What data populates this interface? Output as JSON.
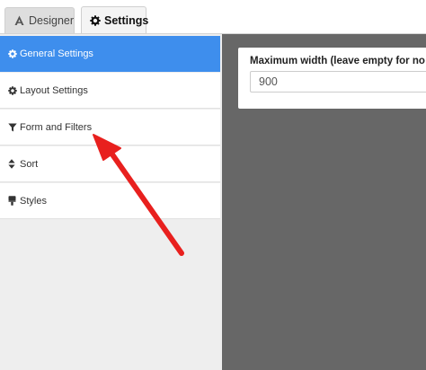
{
  "tabs": [
    {
      "label": "Designer",
      "icon": "designer-icon"
    },
    {
      "label": "Settings",
      "icon": "gear-icon"
    }
  ],
  "sidebar": {
    "items": [
      {
        "label": "General Settings",
        "icon": "gear-icon",
        "active": true
      },
      {
        "label": "Layout Settings",
        "icon": "gear-icon"
      },
      {
        "label": "Form and Filters",
        "icon": "filter-icon"
      },
      {
        "label": "Sort",
        "icon": "sort-icon"
      },
      {
        "label": "Styles",
        "icon": "paint-brush-icon"
      }
    ]
  },
  "main": {
    "max_width": {
      "label": "Maximum width (leave empty for no m",
      "value": "900"
    }
  },
  "annotation": {
    "arrow_color": "#e8201e"
  },
  "colors": {
    "accent": "#3e8eed",
    "main_bg": "#676767",
    "sidebar_bg": "#eeeeee"
  }
}
